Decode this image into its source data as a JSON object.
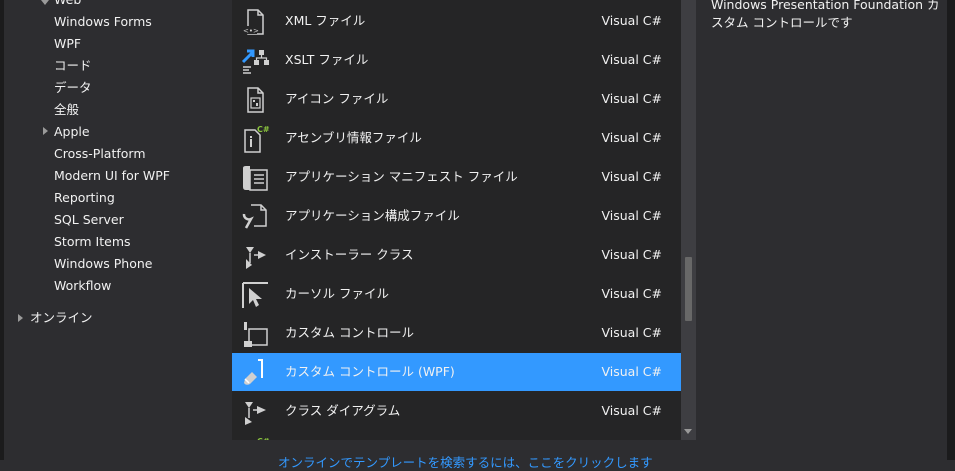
{
  "tree": {
    "items": [
      {
        "label": "Web",
        "arrow": "down"
      },
      {
        "label": "Windows Forms"
      },
      {
        "label": "WPF"
      },
      {
        "label": "コード"
      },
      {
        "label": "データ"
      },
      {
        "label": "全般"
      },
      {
        "label": "Apple",
        "arrow": "right"
      },
      {
        "label": "Cross-Platform"
      },
      {
        "label": "Modern UI for WPF"
      },
      {
        "label": "Reporting"
      },
      {
        "label": "SQL Server"
      },
      {
        "label": "Storm Items"
      },
      {
        "label": "Windows Phone"
      },
      {
        "label": "Workflow"
      }
    ],
    "online": "オンライン"
  },
  "templates": [
    {
      "name": "XML ファイル",
      "lang": "Visual C#",
      "icon": "xml-file-icon"
    },
    {
      "name": "XSLT ファイル",
      "lang": "Visual C#",
      "icon": "xslt-file-icon"
    },
    {
      "name": "アイコン ファイル",
      "lang": "Visual C#",
      "icon": "icon-file-icon"
    },
    {
      "name": "アセンブリ情報ファイル",
      "lang": "Visual C#",
      "icon": "assembly-info-icon"
    },
    {
      "name": "アプリケーション マニフェスト ファイル",
      "lang": "Visual C#",
      "icon": "manifest-file-icon"
    },
    {
      "name": "アプリケーション構成ファイル",
      "lang": "Visual C#",
      "icon": "config-file-icon"
    },
    {
      "name": "インストーラー クラス",
      "lang": "Visual C#",
      "icon": "installer-class-icon"
    },
    {
      "name": "カーソル ファイル",
      "lang": "Visual C#",
      "icon": "cursor-file-icon"
    },
    {
      "name": "カスタム コントロール",
      "lang": "Visual C#",
      "icon": "custom-control-icon"
    },
    {
      "name": "カスタム コントロール (WPF)",
      "lang": "Visual C#",
      "icon": "wpf-custom-control-icon",
      "selected": true
    },
    {
      "name": "クラス ダイアグラム",
      "lang": "Visual C#",
      "icon": "class-diagram-icon"
    }
  ],
  "description": "Windows Presentation Foundation カスタム コントロールです",
  "online_link": "オンラインでテンプレートを検索するには、ここをクリックします",
  "colors": {
    "selection": "#3399ff",
    "list_bg": "#252526",
    "window_bg": "#2d2d30",
    "link": "#3399ff"
  }
}
